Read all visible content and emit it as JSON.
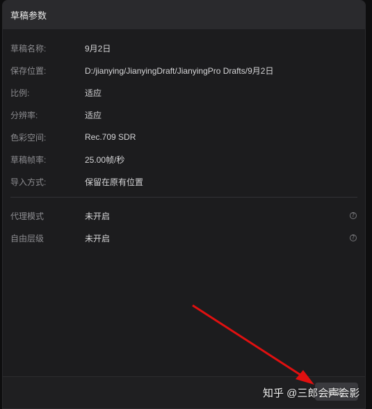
{
  "panel": {
    "title": "草稿参数"
  },
  "rows": [
    {
      "label": "草稿名称:",
      "value": "9月2日"
    },
    {
      "label": "保存位置:",
      "value": "D:/jianying/JianyingDraft/JianyingPro Drafts/9月2日"
    },
    {
      "label": "比例:",
      "value": "适应"
    },
    {
      "label": "分辨率:",
      "value": "适应"
    },
    {
      "label": "色彩空间:",
      "value": "Rec.709 SDR"
    },
    {
      "label": "草稿帧率:",
      "value": "25.00帧/秒"
    },
    {
      "label": "导入方式:",
      "value": "保留在原有位置"
    }
  ],
  "extra_rows": [
    {
      "label": "代理模式",
      "value": "未开启",
      "icon": "help-icon"
    },
    {
      "label": "自由层级",
      "value": "未开启",
      "icon": "help-icon"
    }
  ],
  "footer": {
    "ok_label": "确定"
  },
  "watermark": "知乎 @三郎会声会影",
  "colors": {
    "arrow": "#e01010",
    "panel_bg": "#1c1c1e",
    "header_bg": "#2a2a2d"
  }
}
